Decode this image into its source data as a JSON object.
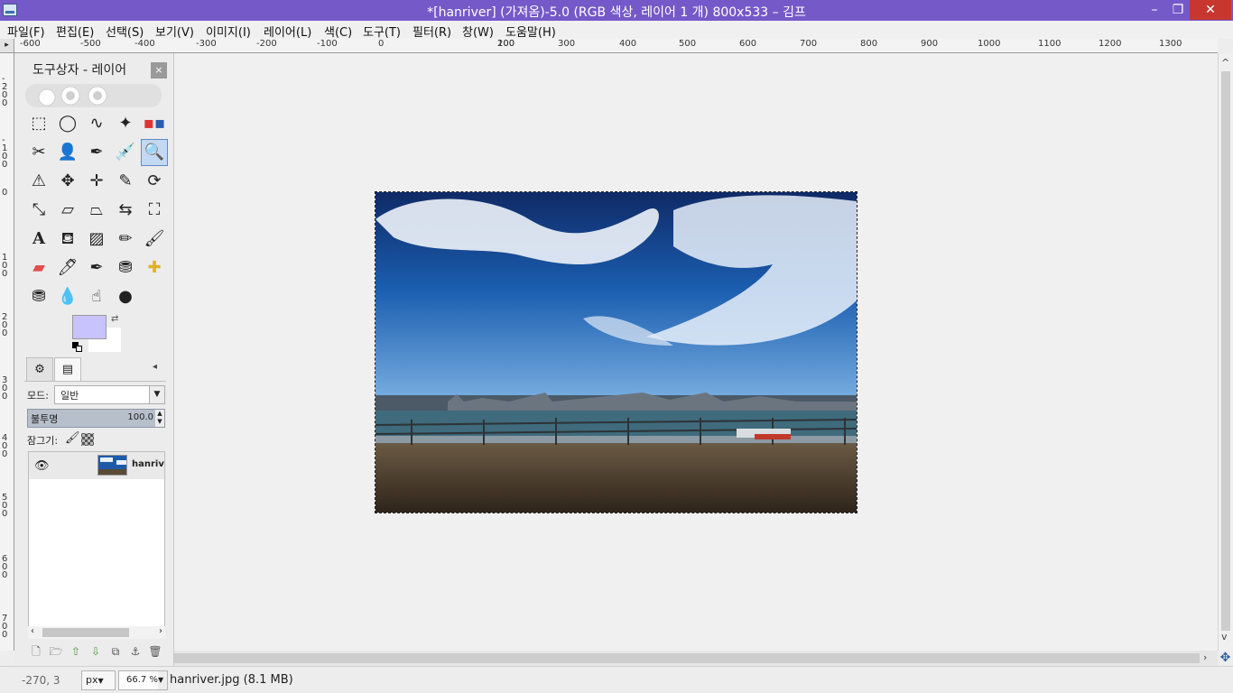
{
  "window": {
    "title": "*[hanriver] (가져옴)-5.0 (RGB 색상, 레이어 1 개) 800x533 – 김프",
    "minimize": "–",
    "maximize": "❐",
    "close": "✕"
  },
  "menubar": {
    "items": [
      "파일(F)",
      "편집(E)",
      "선택(S)",
      "보기(V)",
      "이미지(I)",
      "레이어(L)",
      "색(C)",
      "도구(T)",
      "필터(R)",
      "창(W)",
      "도움말(H)"
    ]
  },
  "ruler": {
    "top_labels": [
      "-600",
      "-500",
      "-400",
      "-300",
      "-200",
      "-100",
      "0",
      "100",
      "200",
      "300",
      "400",
      "500",
      "600",
      "700",
      "800",
      "900",
      "1000",
      "1100",
      "1200",
      "1300"
    ],
    "left_labels": [
      "-200",
      "-100",
      "0",
      "100",
      "200",
      "300",
      "400",
      "500",
      "600",
      "700"
    ]
  },
  "dock": {
    "title": "도구상자 - 레이어",
    "close": "×",
    "active_tool": "zoom-tool",
    "colors": {
      "foreground": "#c8c3fc",
      "background": "#ffffff"
    }
  },
  "layers": {
    "mode_label": "모드:",
    "mode_value": "일반",
    "opacity_label": "불투명",
    "opacity_value": "100.0",
    "lock_label": "잠그기:",
    "layer_name": "hanriver"
  },
  "statusbar": {
    "pointer_coords": "-270, 3",
    "unit": "px",
    "zoom": "66.7 %",
    "message": "hanriver.jpg (8.1 MB)"
  }
}
